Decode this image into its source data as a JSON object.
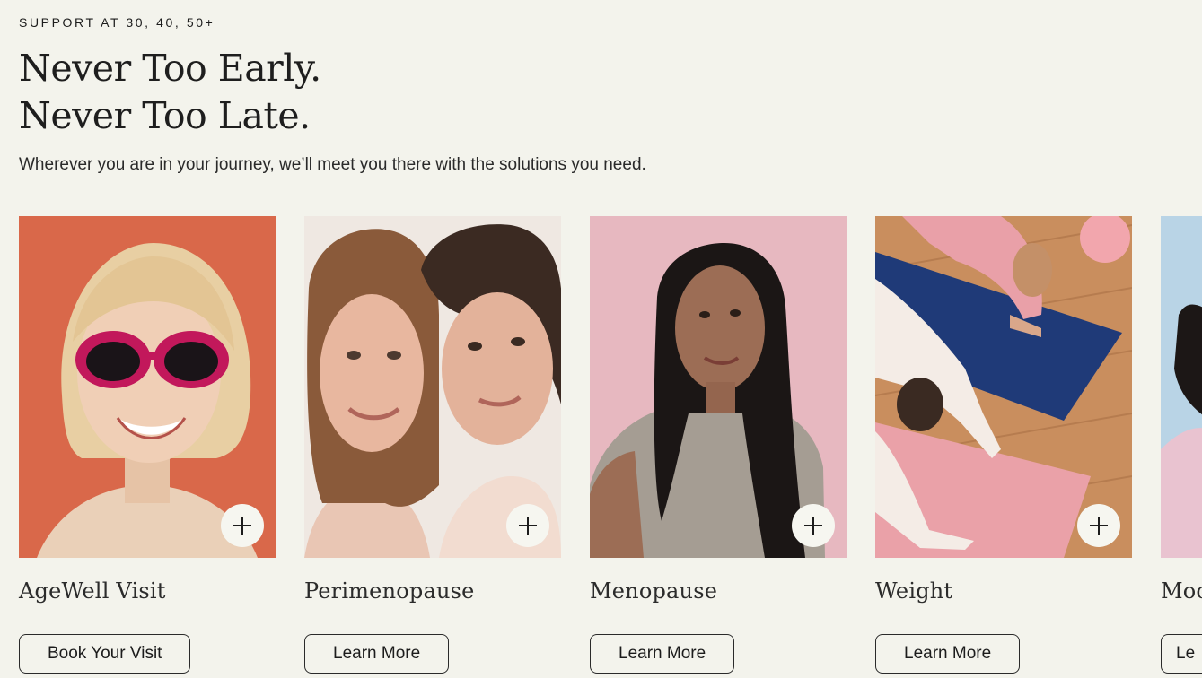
{
  "section": {
    "eyebrow": "SUPPORT AT 30, 40, 50+",
    "headline_line1": "Never Too Early.",
    "headline_line2": "Never Too Late.",
    "subtitle": "Wherever you are in your journey, we’ll meet you there with the solutions you need."
  },
  "cards": [
    {
      "title": "AgeWell Visit",
      "cta": "Book Your Visit",
      "icon": "plus-icon"
    },
    {
      "title": "Perimenopause",
      "cta": "Learn More",
      "icon": "plus-icon"
    },
    {
      "title": "Menopause",
      "cta": "Learn More",
      "icon": "plus-icon"
    },
    {
      "title": "Weight",
      "cta": "Learn More",
      "icon": "plus-icon"
    },
    {
      "title": "Moo",
      "cta": "Le",
      "icon": "plus-icon"
    }
  ],
  "colors": {
    "page_background": "#f3f3ec",
    "card1_background": "#d9684a",
    "card2_background": "#efe8e2",
    "card3_background": "#e7b8c0",
    "card4_background": "#c98e5e",
    "card5_background": "#b9d4e6",
    "text": "#1c1c1c"
  }
}
